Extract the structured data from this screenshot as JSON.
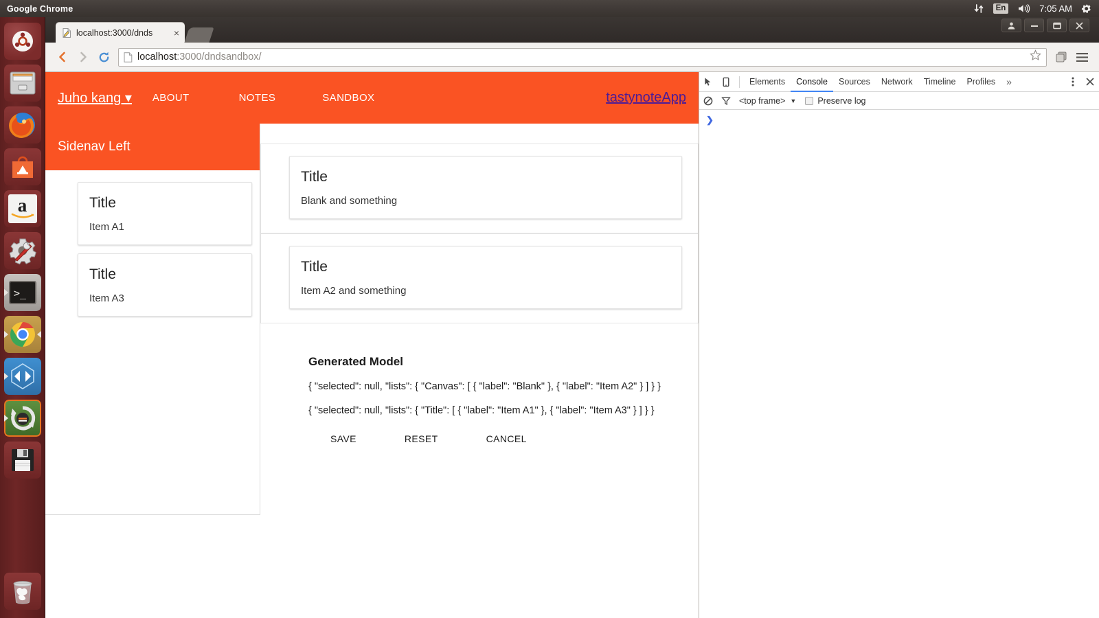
{
  "desktop": {
    "panel": {
      "app_title": "Google Chrome",
      "network_icon": "network-updown-icon",
      "keyboard_layout": "En",
      "volume_icon": "volume-icon",
      "clock": "7:05 AM",
      "system_icon": "system-gear-icon"
    },
    "launcher": {
      "items": [
        {
          "name": "ubuntu-dash-icon",
          "label": "Ubuntu Dash",
          "running": false
        },
        {
          "name": "files-icon",
          "label": "Files",
          "running": false
        },
        {
          "name": "firefox-icon",
          "label": "Firefox",
          "running": false
        },
        {
          "name": "ubuntu-software-icon",
          "label": "Ubuntu Software",
          "running": false
        },
        {
          "name": "amazon-icon",
          "label": "Amazon",
          "running": false
        },
        {
          "name": "system-settings-icon",
          "label": "System Settings",
          "running": false
        },
        {
          "name": "terminal-icon",
          "label": "Terminal",
          "running": true
        },
        {
          "name": "google-chrome-icon",
          "label": "Google Chrome",
          "running": true
        },
        {
          "name": "visual-studio-icon",
          "label": "Visual Studio",
          "running": true
        },
        {
          "name": "software-updater-icon",
          "label": "Software Updater",
          "running": true
        },
        {
          "name": "disk-save-icon",
          "label": "Startup Disk Creator",
          "running": false
        }
      ],
      "trash": {
        "name": "trash-icon",
        "label": "Trash"
      }
    }
  },
  "browser": {
    "window_buttons": {
      "profile": "profile-icon",
      "minimize": "minimize-icon",
      "maximize": "maximize-icon",
      "close": "close-icon"
    },
    "tab": {
      "title": "localhost:3000/dnds",
      "favicon": "page-edit-icon",
      "close_label": "×"
    },
    "new_tab_label": "+",
    "toolbar": {
      "back_label": "‹",
      "forward_label": "›",
      "reload_label": "↻",
      "url_host": "localhost",
      "url_path": ":3000/dndsandbox/",
      "bookmark_icon": "star-icon",
      "extension_icon": "extension-icon",
      "menu_icon": "hamburger-menu-icon"
    }
  },
  "page": {
    "header": {
      "user_menu": "Juho kang ▾",
      "nav": [
        {
          "label": "ABOUT"
        },
        {
          "label": "NOTES"
        },
        {
          "label": "SANDBOX"
        }
      ],
      "brand": "tastynoteApp",
      "background_color": "#FA5323",
      "brand_color": "#4b1b97"
    },
    "sidenav": {
      "title": "Sidenav Left",
      "cards": [
        {
          "title": "Title",
          "body": "Item A1"
        },
        {
          "title": "Title",
          "body": "Item A3"
        }
      ]
    },
    "canvas": {
      "dropzones": [
        {
          "cards": [
            {
              "title": "Title",
              "body": "Blank and something"
            }
          ]
        },
        {
          "cards": [
            {
              "title": "Title",
              "body": "Item A2 and something"
            }
          ]
        }
      ]
    },
    "model": {
      "heading": "Generated Model",
      "lines": [
        "{ \"selected\": null, \"lists\": { \"Canvas\": [ { \"label\": \"Blank\" }, { \"label\": \"Item A2\" } ] } }",
        "{ \"selected\": null, \"lists\": { \"Title\": [ { \"label\": \"Item A1\" }, { \"label\": \"Item A3\" } ] } }"
      ],
      "actions": [
        {
          "label": "SAVE"
        },
        {
          "label": "RESET"
        },
        {
          "label": "CANCEL"
        }
      ]
    }
  },
  "devtools": {
    "inspect_icon": "inspect-element-icon",
    "device_icon": "device-toolbar-icon",
    "tabs": [
      {
        "label": "Elements",
        "active": false
      },
      {
        "label": "Console",
        "active": true
      },
      {
        "label": "Sources",
        "active": false
      },
      {
        "label": "Network",
        "active": false
      },
      {
        "label": "Timeline",
        "active": false
      },
      {
        "label": "Profiles",
        "active": false
      }
    ],
    "more_tabs_label": "»",
    "kebab_icon": "more-options-icon",
    "close_icon": "close-devtools-icon",
    "console_toolbar": {
      "clear_icon": "clear-console-icon",
      "filter_icon": "filter-icon",
      "frame_selector": "<top frame>",
      "frame_caret": "▼",
      "preserve_log_label": "Preserve log",
      "preserve_log_checked": false
    },
    "console_prompt": "❯"
  }
}
